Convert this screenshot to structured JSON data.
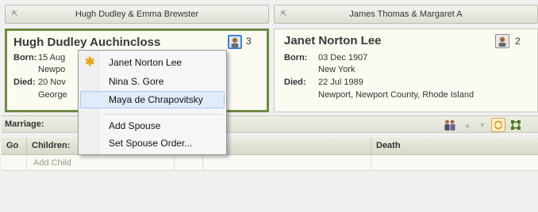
{
  "families": {
    "left": {
      "title": "Hugh Dudley & Emma Brewster"
    },
    "right": {
      "title": "James Thomas & Margaret A"
    }
  },
  "husband": {
    "name": "Hugh Dudley Auchincloss",
    "born_label": "Born:",
    "born_date": "15 Aug",
    "born_place": "Newpo",
    "died_label": "Died:",
    "died_date": "20 Nov",
    "died_place": "George",
    "spouse_count": "3"
  },
  "wife": {
    "name": "Janet Norton Lee",
    "born_label": "Born:",
    "born_date": "03 Dec 1907",
    "born_place": "New York",
    "died_label": "Died:",
    "died_date": "22 Jul 1989",
    "died_place": "Newport, Newport County, Rhode Island",
    "spouse_count": "2"
  },
  "marriage": {
    "label": "Marriage:"
  },
  "children_grid": {
    "columns": [
      "Go",
      "Children:",
      "",
      "",
      "Death"
    ],
    "add_child": "Add Child"
  },
  "context_menu": {
    "spouses": [
      "Janet Norton Lee",
      "Nina S. Gore",
      "Maya de Chrapovitsky"
    ],
    "actions": [
      "Add Spouse",
      "Set Spouse Order..."
    ],
    "current_spouse_index": 0,
    "hovered_index": 2
  },
  "colors": {
    "selected_border": "#6e8a43",
    "menu_highlight": "#e1ecfa",
    "star": "#e8a317"
  }
}
